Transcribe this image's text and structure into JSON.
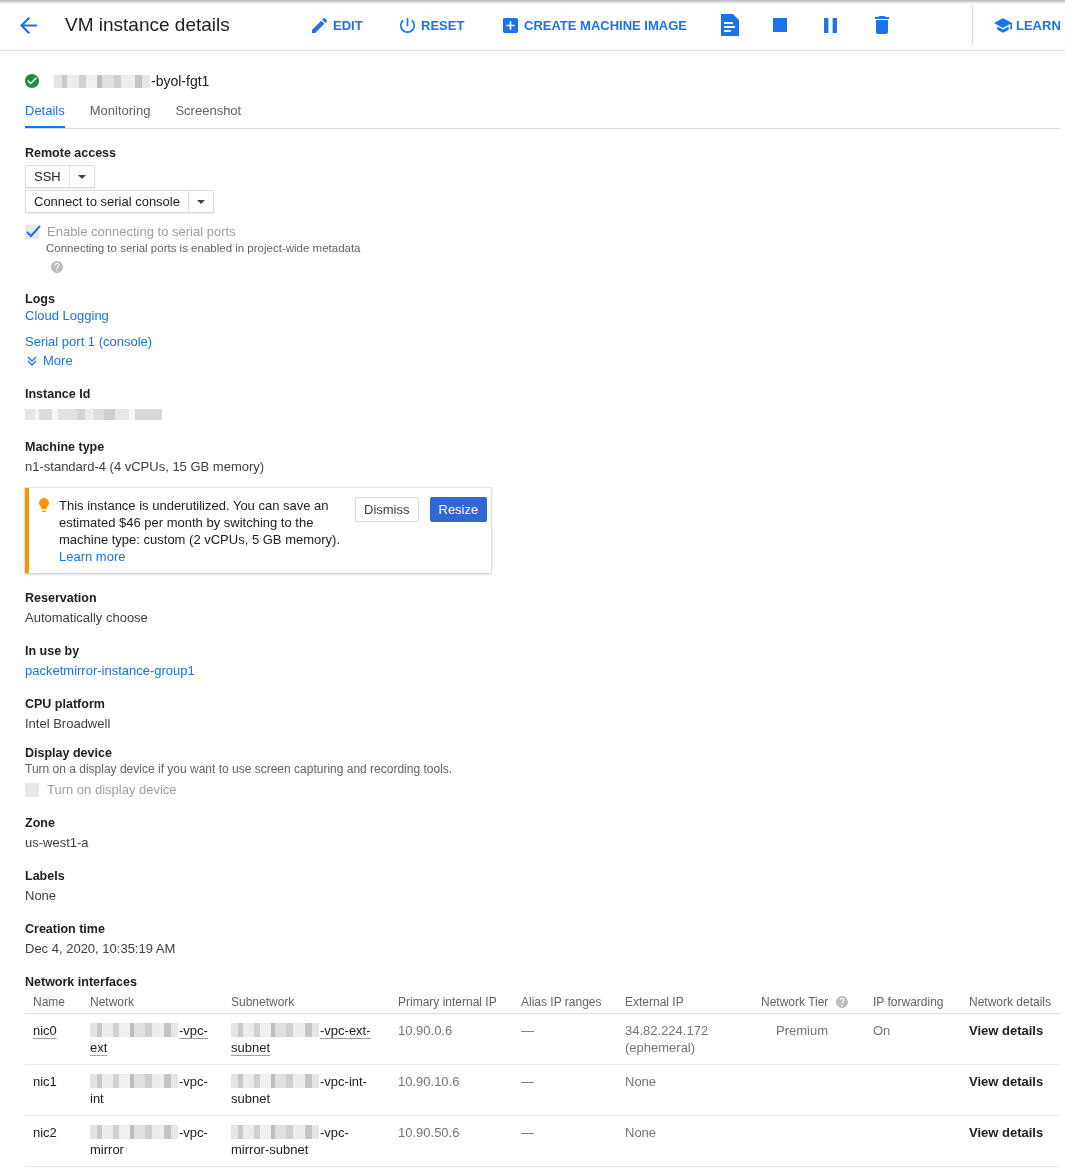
{
  "toolbar": {
    "title": "VM instance details",
    "actions": [
      {
        "label": "EDIT"
      },
      {
        "label": "RESET"
      },
      {
        "label": "CREATE MACHINE IMAGE"
      }
    ],
    "learn": "LEARN"
  },
  "instance": {
    "running": true,
    "name": "-byol-fgt1",
    "redacted": true
  },
  "tabs": [
    {
      "label": "Details",
      "selected": true
    },
    {
      "label": "Monitoring",
      "selected": false
    },
    {
      "label": "Screenshot",
      "selected": false
    }
  ],
  "remote_access": {
    "label": "Remote access",
    "buttons": [
      {
        "label": "SSH"
      },
      {
        "label": "Connect to serial console"
      }
    ],
    "checkbox": {
      "label": "Enable connecting to serial ports",
      "checked": true,
      "disabled": true
    },
    "hint": "Connecting to serial ports is enabled in project-wide metadata",
    "help": true
  },
  "logs": {
    "label": "Logs",
    "links": [
      "Cloud Logging",
      "Serial port 1 (console)"
    ],
    "more": "More"
  },
  "sections": [
    {
      "kind": "redacted",
      "label": "Instance Id"
    },
    {
      "kind": "text",
      "label": "Machine type",
      "value": "n1-standard-4 (4 vCPUs, 15 GB memory)"
    },
    {
      "kind": "recommendation",
      "text": "This instance is underutilized. You can save an estimated $46 per month by switching to the machine type: custom (2 vCPUs, 5 GB memory).",
      "link": "Learn more",
      "buttons": [
        {
          "label": "Dismiss",
          "primary": false
        },
        {
          "label": "Resize",
          "primary": true
        }
      ]
    },
    {
      "kind": "text",
      "label": "Reservation",
      "value": "Automatically choose"
    },
    {
      "kind": "link",
      "label": "In use by",
      "value": "packetmirror-instance-group1"
    },
    {
      "kind": "text",
      "label": "CPU platform",
      "value": "Intel Broadwell"
    },
    {
      "kind": "toggle",
      "label": "Display device",
      "hint": "Turn on a display device if you want to use screen capturing and recording tools.",
      "checkbox": {
        "label": "Turn on display device",
        "checked": false,
        "disabled": true
      }
    },
    {
      "kind": "text",
      "label": "Zone",
      "value": "us-west1-a"
    },
    {
      "kind": "text",
      "label": "Labels",
      "value": "None"
    },
    {
      "kind": "text",
      "label": "Creation time",
      "value": "Dec 4, 2020, 10:35:19 AM"
    }
  ],
  "network_interfaces": {
    "label": "Network interfaces",
    "columns": [
      {
        "label": "Name"
      },
      {
        "label": "Network"
      },
      {
        "label": "Subnetwork"
      },
      {
        "label": "Primary internal IP"
      },
      {
        "label": "Alias IP ranges"
      },
      {
        "label": "External IP"
      },
      {
        "label": "Network Tier",
        "help": true
      },
      {
        "label": "IP forwarding"
      },
      {
        "label": "Network details"
      }
    ],
    "rows": [
      {
        "hovered": true,
        "name": "nic0",
        "network": {
          "text": "-vpc-ext",
          "redacted": true
        },
        "subnetwork": {
          "text": "-vpc-ext-subnet",
          "redacted": true
        },
        "primary_ip": "10.90.0.6",
        "alias_ip": "—",
        "external_ip": "34.82.224.172 (ephemeral)",
        "network_tier": "Premium",
        "ip_forwarding": "On",
        "details": "View details"
      },
      {
        "hovered": false,
        "name": "nic1",
        "network": {
          "text": "-vpc-int",
          "redacted": true
        },
        "subnetwork": {
          "text": "-vpc-int-subnet",
          "redacted": true
        },
        "primary_ip": "10.90.10.6",
        "alias_ip": "—",
        "external_ip": "None",
        "details": "View details"
      },
      {
        "hovered": false,
        "name": "nic2",
        "network": {
          "text": "-vpc-mirror",
          "redacted": true
        },
        "subnetwork": {
          "text": "-vpc-mirror-subnet",
          "redacted": true
        },
        "primary_ip": "10.90.50.6",
        "alias_ip": "—",
        "external_ip": "None",
        "details": "View details"
      }
    ]
  }
}
